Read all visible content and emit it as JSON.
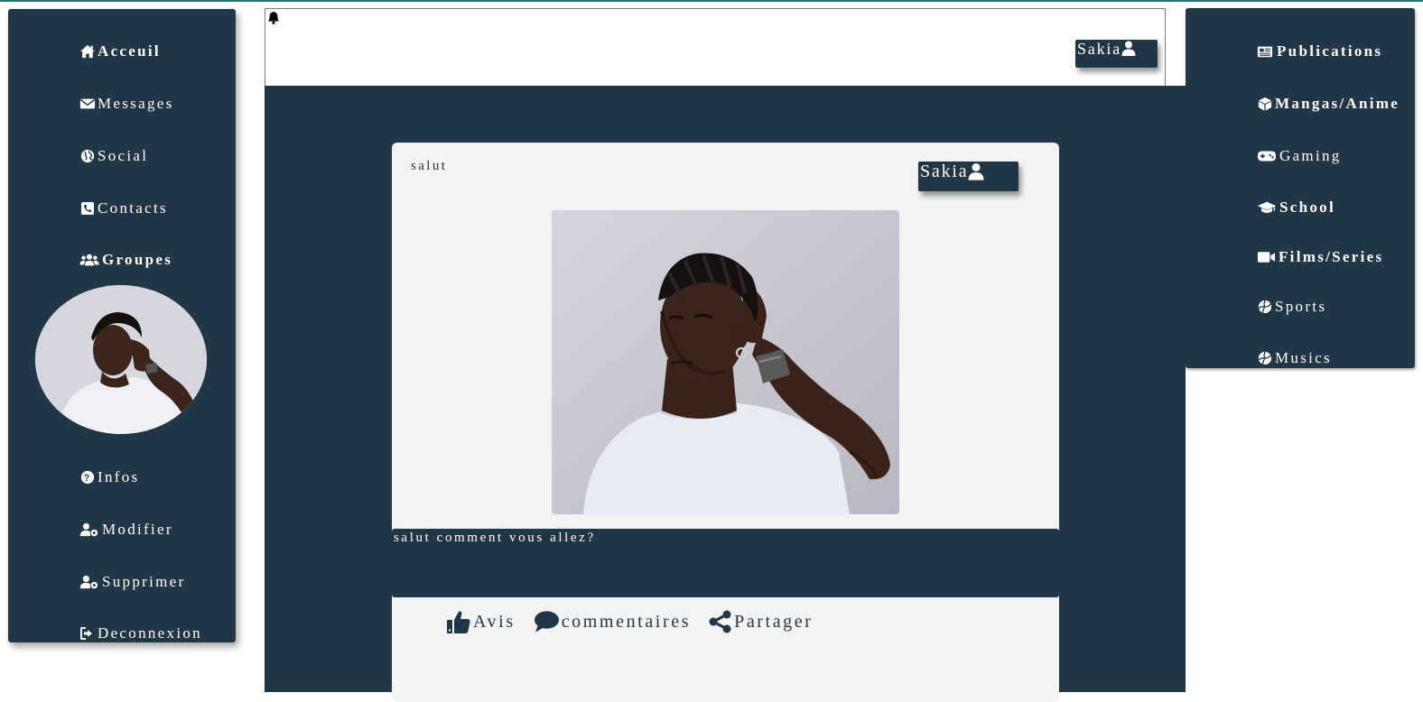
{
  "left_nav": {
    "items": [
      {
        "label": "Acceuil",
        "icon": "home-icon"
      },
      {
        "label": "Messages",
        "icon": "envelope-icon"
      },
      {
        "label": "Social",
        "icon": "globe-icon"
      },
      {
        "label": "Contacts",
        "icon": "phone-icon"
      },
      {
        "label": "Groupes",
        "icon": "users-icon"
      }
    ],
    "bottom_items": [
      {
        "label": "Infos",
        "icon": "question-circle-icon"
      },
      {
        "label": "Modifier",
        "icon": "user-cog-icon"
      },
      {
        "label": "Supprimer",
        "icon": "user-cog-icon"
      },
      {
        "label": "Deconnexion",
        "icon": "sign-out-icon"
      }
    ]
  },
  "header": {
    "notification_icon": "bell-icon",
    "user_name": "Sakia"
  },
  "post": {
    "title": "salut",
    "author": "Sakia",
    "text": "salut comment vous allez?",
    "actions": [
      {
        "label": "Avis",
        "icon": "thumbs-up-icon"
      },
      {
        "label": "commentaires",
        "icon": "comment-icon"
      },
      {
        "label": "Partager",
        "icon": "share-icon"
      }
    ]
  },
  "right_nav": {
    "items": [
      {
        "label": "Publications",
        "icon": "newspaper-icon"
      },
      {
        "label": "Mangas/Anime",
        "icon": "cube-icon"
      },
      {
        "label": "Gaming",
        "icon": "gamepad-icon"
      },
      {
        "label": "School",
        "icon": "graduation-cap-icon"
      },
      {
        "label": "Films/Series",
        "icon": "video-icon"
      },
      {
        "label": "Sports",
        "icon": "volleyball-icon"
      },
      {
        "label": "Musics",
        "icon": "volleyball-icon"
      }
    ]
  },
  "colors": {
    "navy": "#223746",
    "card": "#f3f3f3",
    "accent_line": "#2a6e75"
  }
}
